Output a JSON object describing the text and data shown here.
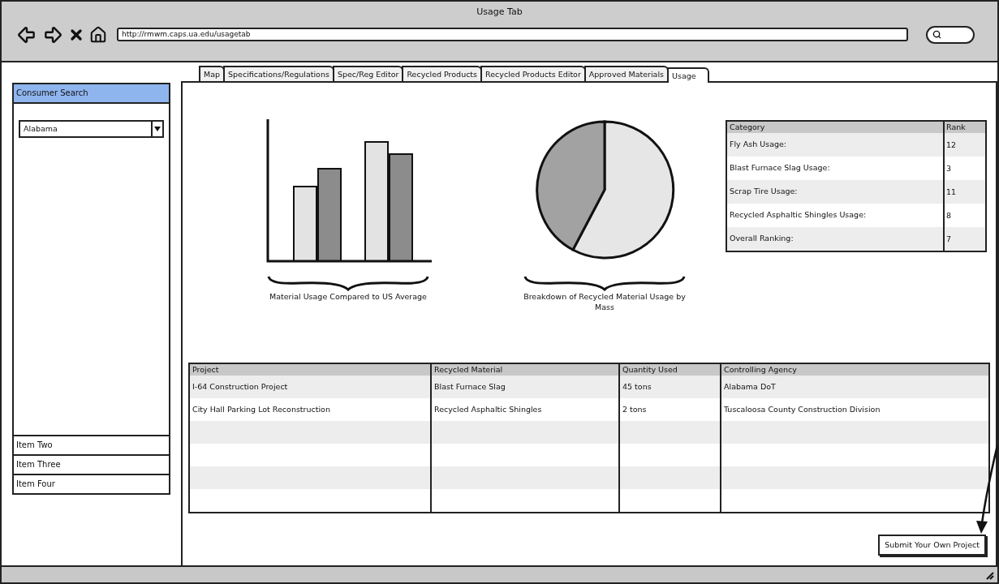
{
  "window": {
    "title": "Usage Tab",
    "url": "http://rmwm.caps.ua.edu/usagetab"
  },
  "tabs": [
    {
      "label": "Map",
      "selected": false
    },
    {
      "label": "Specifications/Regulations",
      "selected": false
    },
    {
      "label": "Spec/Reg Editor",
      "selected": false
    },
    {
      "label": "Recycled Products",
      "selected": false
    },
    {
      "label": "Recycled Products Editor",
      "selected": false
    },
    {
      "label": "Approved Materials",
      "selected": false
    },
    {
      "label": "Usage",
      "selected": true
    }
  ],
  "sidebar": {
    "sections": [
      {
        "label": "Consumer Search",
        "selected": true
      },
      {
        "label": "Item Two",
        "selected": false
      },
      {
        "label": "Item Three",
        "selected": false
      },
      {
        "label": "Item Four",
        "selected": false
      }
    ],
    "state_select": {
      "value": "Alabama"
    }
  },
  "bar_chart": {
    "caption": "Material Usage Compared to US Average"
  },
  "pie_chart": {
    "caption": "Breakdown of Recycled Material Usage by Mass"
  },
  "rank_table": {
    "columns": [
      "Category",
      "Rank"
    ],
    "rows": [
      [
        "Fly Ash Usage:",
        "12"
      ],
      [
        "Blast Furnace Slag Usage:",
        "3"
      ],
      [
        "Scrap Tire Usage:",
        "11"
      ],
      [
        "Recycled Asphaltic Shingles Usage:",
        "8"
      ],
      [
        "Overall Ranking:",
        "7"
      ]
    ]
  },
  "projects_table": {
    "columns": [
      "Project",
      "Recycled Material",
      "Quantity Used",
      "Controlling Agency"
    ],
    "rows": [
      [
        "I-64 Construction Project",
        "Blast Furnace Slag",
        "45 tons",
        "Alabama DoT"
      ],
      [
        "City Hall Parking Lot Reconstruction",
        "Recycled Asphaltic Shingles",
        "2 tons",
        "Tuscaloosa County Construction Division"
      ]
    ]
  },
  "submit_button": {
    "label": "Submit Your Own Project"
  }
}
